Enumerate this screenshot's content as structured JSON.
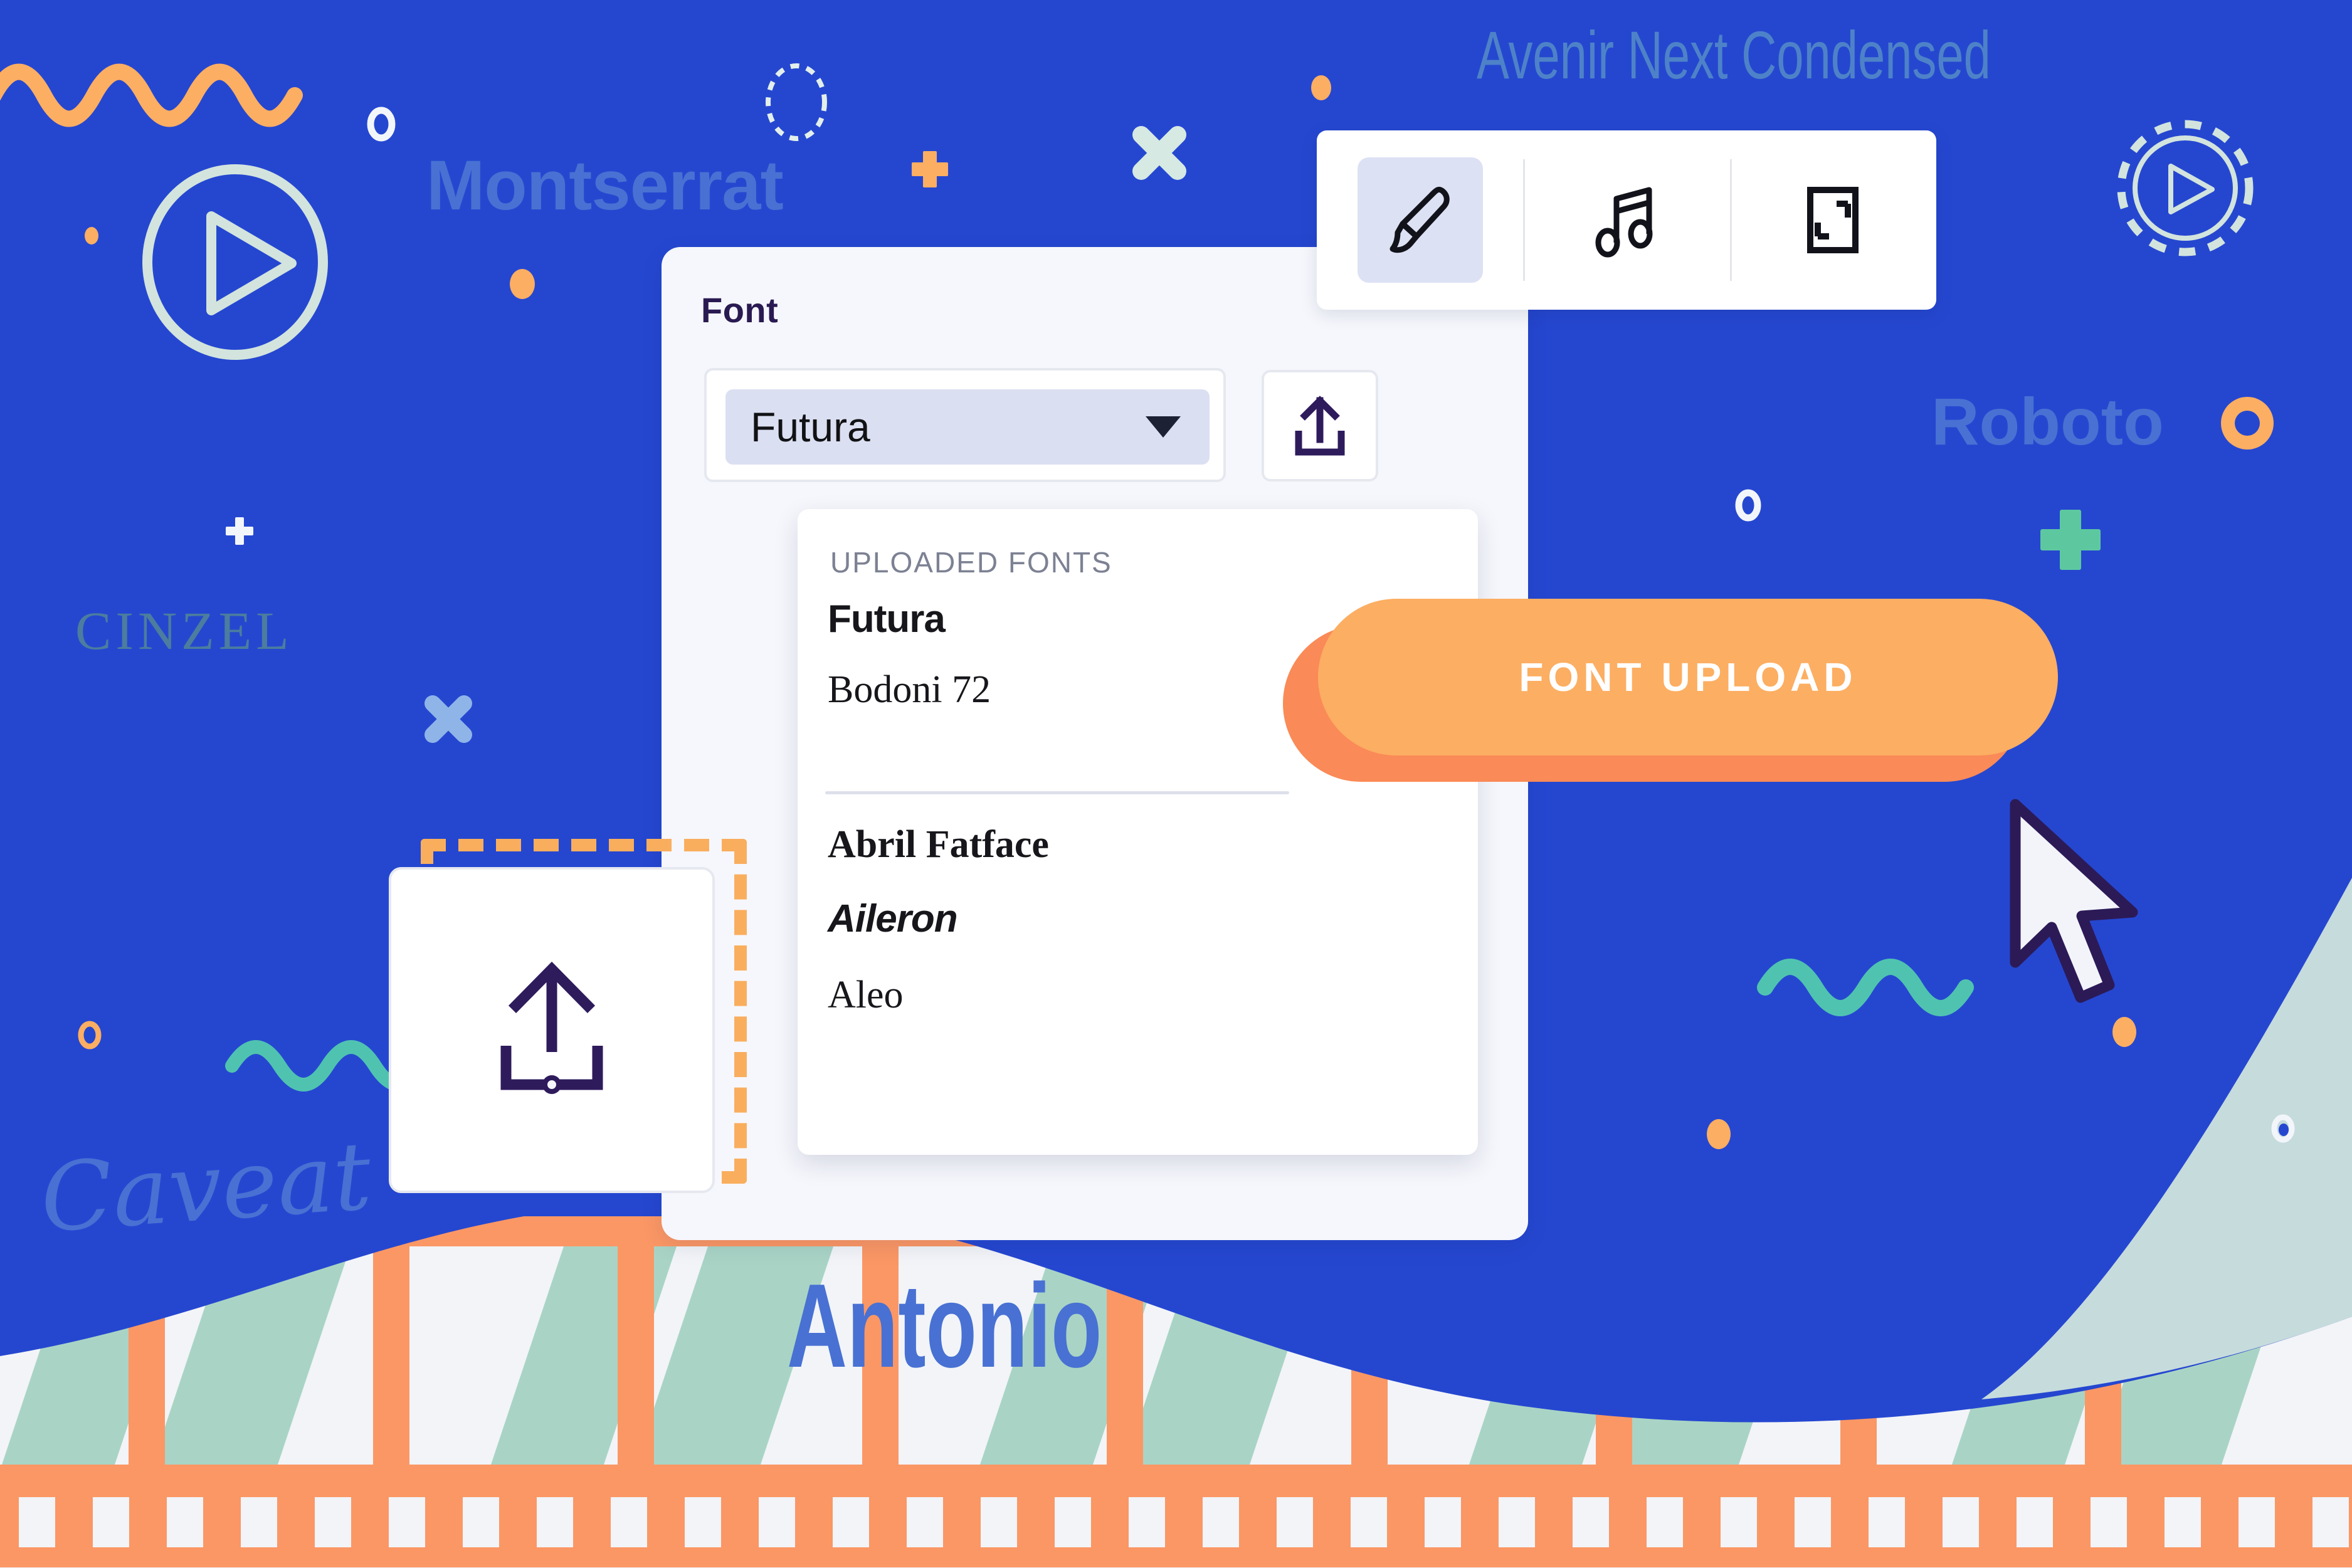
{
  "background": {
    "base_color": "#2547D0",
    "mint_color": "#CFE4DC",
    "ghost_font_labels": [
      {
        "name": "Montserrat",
        "text": "Montserrat"
      },
      {
        "name": "Avenir Next Condensed",
        "text": "Avenir Next Condensed"
      },
      {
        "name": "Cinzel",
        "text": "CINZEL"
      },
      {
        "name": "Roboto",
        "text": "Roboto"
      },
      {
        "name": "Caveat",
        "text": "Caveat"
      },
      {
        "name": "Antonio",
        "text": "Antonio"
      }
    ],
    "decorations": [
      "orange-squiggle",
      "white-ring",
      "play-button-circle",
      "dashed-circle",
      "orange-plus",
      "mint-x",
      "orange-dot",
      "green-plus",
      "orange-donut",
      "teal-squiggle",
      "film-strip"
    ]
  },
  "toolbar": {
    "items": [
      {
        "icon": "paintbrush-icon",
        "label": "Brush",
        "selected": true
      },
      {
        "icon": "music-note-icon",
        "label": "Audio",
        "selected": false
      },
      {
        "icon": "crop-frame-icon",
        "label": "Resize",
        "selected": false
      }
    ]
  },
  "panel": {
    "title": "Font",
    "font_select": {
      "value": "Futura",
      "caret_icon": "chevron-down-icon"
    },
    "upload_icon_button": {
      "icon": "upload-icon",
      "label": "Upload font"
    },
    "dropdown": {
      "header": "UPLOADED FONTS",
      "uploaded": [
        {
          "name": "Futura"
        },
        {
          "name": "Bodoni 72"
        }
      ],
      "system": [
        {
          "name": "Abril Fatface"
        },
        {
          "name": "Aileron"
        },
        {
          "name": "Aleo"
        }
      ],
      "scrollbar": {
        "name": "dropdown-scrollbar"
      }
    }
  },
  "upload_card": {
    "icon": "upload-tray-icon",
    "selection_box": "dashed-selection-box",
    "accent_color": "#F9AE5E"
  },
  "cta": {
    "label": "FONT UPLOAD",
    "fill_color": "#FCAE62",
    "shadow_color": "#FA8A57",
    "cursor": "mouse-pointer-cursor"
  }
}
